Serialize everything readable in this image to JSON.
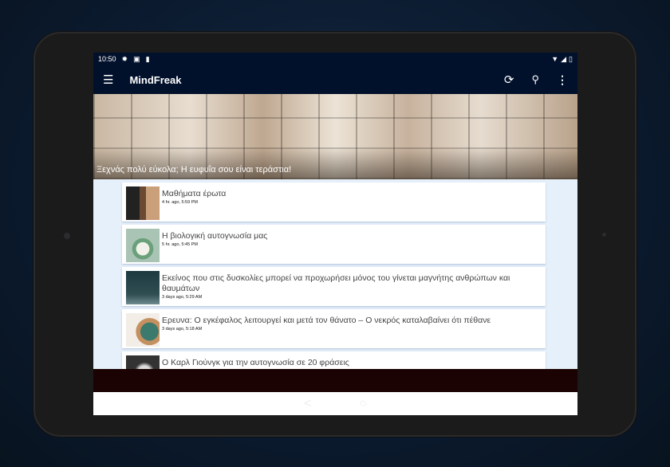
{
  "status_bar": {
    "time": "10:50"
  },
  "toolbar": {
    "title": "MindFreak"
  },
  "banner": {
    "caption": "Ξεχνάς πολύ εύκολα; Η ευφυΐα σου είναι τεράστια!"
  },
  "articles": [
    {
      "title": "Μαθήματα έρωτα",
      "time": "4 hr. ago, 5:59 PM"
    },
    {
      "title": "Η βιολογική αυτογνωσία μας",
      "time": "5 hr. ago, 5:45 PM"
    },
    {
      "title": "Εκείνος που στις δυσκολίες μπορεί να προχωρήσει μόνος του γίνεται μαγνήτης ανθρώπων και θαυμάτων",
      "time": "3 days ago, 5:29 AM"
    },
    {
      "title": "Ερευνα: Ο εγκέφαλος λειτουργεί και μετά τον θάνατο – Ο νεκρός καταλαβαίνει ότι πέθανε",
      "time": "3 days ago, 5:18 AM"
    },
    {
      "title": "Ο Καρλ Γιούνγκ για την αυτογνωσία σε 20 φράσεις",
      "time": ""
    }
  ],
  "colors": {
    "appbar": "#02112b",
    "list_bg": "#e6f0fb",
    "ad_bar": "#1c0303"
  }
}
